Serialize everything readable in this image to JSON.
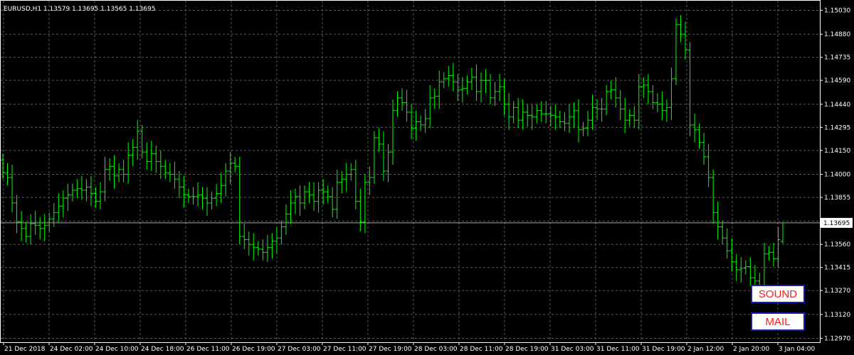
{
  "header": {
    "text": "EURUSD,H1  1.13579 1.13695 1.13565 1.13695"
  },
  "buttons": {
    "sound": "SOUND",
    "mail": "MAIL"
  },
  "colors": {
    "background": "#000000",
    "bars": "#00ff00",
    "grid": "#5b5b5b",
    "axis_text": "#ffffff",
    "price_line": "#a8a8a8",
    "button_text": "#ff1a1a",
    "button_border": "#1c1ca8"
  },
  "chart_data": {
    "type": "ohlc",
    "title": "EURUSD,H1",
    "ohlc_header": {
      "open": 1.13579,
      "high": 1.13695,
      "low": 1.13565,
      "close": 1.13695
    },
    "current_price_label": "1.13695",
    "ylim": [
      1.1297,
      1.1503
    ],
    "y_ticks": [
      "1.15030",
      "1.14880",
      "1.14735",
      "1.14590",
      "1.14440",
      "1.14295",
      "1.14150",
      "1.14000",
      "1.13855",
      "1.13705",
      "1.13560",
      "1.13415",
      "1.13270",
      "1.13120",
      "1.12970"
    ],
    "x_ticks": [
      "21 Dec 2018",
      "24 Dec 02:00",
      "24 Dec 10:00",
      "24 Dec 18:00",
      "26 Dec 11:00",
      "26 Dec 19:00",
      "27 Dec 03:00",
      "27 Dec 11:00",
      "27 Dec 19:00",
      "28 Dec 03:00",
      "28 Dec 11:00",
      "28 Dec 19:00",
      "31 Dec 03:00",
      "31 Dec 11:00",
      "31 Dec 19:00",
      "2 Jan 12:00",
      "2 Jan 20:00",
      "3 Jan 04:00"
    ],
    "grid": true,
    "closes": [
      1.1401,
      1.1398,
      1.1382,
      1.137,
      1.1366,
      1.1361,
      1.1369,
      1.1368,
      1.1366,
      1.1368,
      1.1372,
      1.1376,
      1.138,
      1.1385,
      1.1387,
      1.139,
      1.1391,
      1.139,
      1.1392,
      1.1388,
      1.1383,
      1.1389,
      1.1403,
      1.1405,
      1.1399,
      1.1403,
      1.14,
      1.1412,
      1.1417,
      1.1427,
      1.1414,
      1.1408,
      1.1413,
      1.1408,
      1.1405,
      1.1401,
      1.14,
      1.1397,
      1.1392,
      1.1387,
      1.1386,
      1.1386,
      1.1387,
      1.1385,
      1.1382,
      1.1385,
      1.1388,
      1.1393,
      1.1402,
      1.1407,
      1.1405,
      1.1361,
      1.1359,
      1.1356,
      1.1354,
      1.1353,
      1.1351,
      1.1354,
      1.1358,
      1.136,
      1.1367,
      1.1375,
      1.1382,
      1.1386,
      1.1382,
      1.1389,
      1.1387,
      1.1383,
      1.139,
      1.1389,
      1.1386,
      1.1378,
      1.1395,
      1.1397,
      1.14,
      1.1403,
      1.1383,
      1.137,
      1.1395,
      1.1398,
      1.1423,
      1.1419,
      1.1402,
      1.1414,
      1.144,
      1.1448,
      1.1445,
      1.1439,
      1.1429,
      1.1433,
      1.1431,
      1.1435,
      1.1448,
      1.1449,
      1.1458,
      1.146,
      1.1462,
      1.1458,
      1.1453,
      1.1454,
      1.1458,
      1.1461,
      1.1452,
      1.1459,
      1.1459,
      1.1448,
      1.1452,
      1.1455,
      1.1444,
      1.1436,
      1.1442,
      1.1434,
      1.1439,
      1.1437,
      1.1436,
      1.144,
      1.1438,
      1.1438,
      1.1437,
      1.1436,
      1.1433,
      1.1432,
      1.1436,
      1.144,
      1.1428,
      1.1429,
      1.1434,
      1.1442,
      1.1441,
      1.1441,
      1.1452,
      1.1453,
      1.1448,
      1.1441,
      1.1434,
      1.1437,
      1.1434,
      1.1455,
      1.1456,
      1.1452,
      1.1445,
      1.1444,
      1.144,
      1.1442,
      1.146,
      1.1494,
      1.1488,
      1.1478,
      1.1431,
      1.1428,
      1.142,
      1.1411,
      1.1398,
      1.1376,
      1.1367,
      1.136,
      1.1352,
      1.1345,
      1.134,
      1.1341,
      1.1342,
      1.1335,
      1.1333,
      1.133,
      1.135,
      1.1351,
      1.1347,
      1.1359,
      1.13695
    ]
  }
}
